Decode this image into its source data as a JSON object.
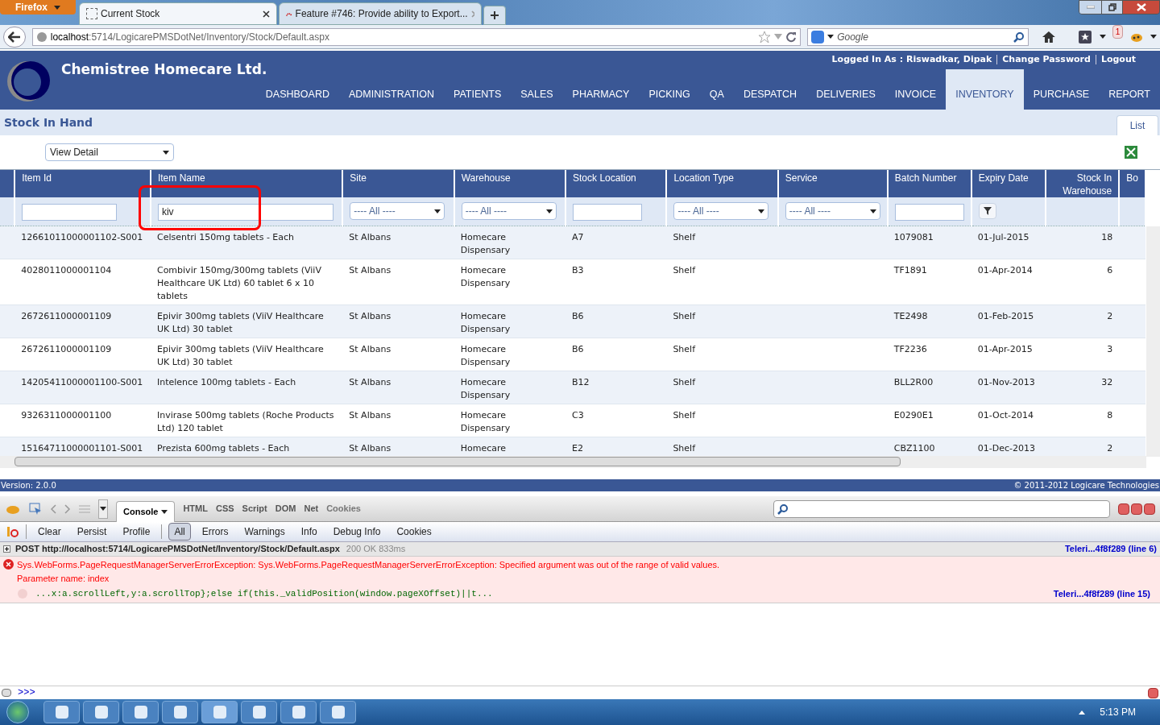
{
  "browser": {
    "menu_button": "Firefox",
    "tabs": [
      {
        "title": "Current Stock",
        "selected": true,
        "kind": "blank"
      },
      {
        "title": "Feature #746: Provide ability to Export...",
        "selected": false,
        "kind": "logo"
      }
    ],
    "url_host": "localhost",
    "url_path": ":5714/LogicarePMSDotNet/Inventory/Stock/Default.aspx",
    "search_placeholder": "Google",
    "badge": "1"
  },
  "site": {
    "company": "Chemistree Homecare Ltd.",
    "user_links": [
      "Logged In As : Riswadkar, Dipak",
      "Change Password",
      "Logout"
    ],
    "nav": [
      {
        "label": "DASHBOARD",
        "selected": false
      },
      {
        "label": "ADMINISTRATION",
        "selected": false
      },
      {
        "label": "PATIENTS",
        "selected": false
      },
      {
        "label": "SALES",
        "selected": false
      },
      {
        "label": "PHARMACY",
        "selected": false
      },
      {
        "label": "PICKING",
        "selected": false
      },
      {
        "label": "QA",
        "selected": false
      },
      {
        "label": "DESPATCH",
        "selected": false
      },
      {
        "label": "DELIVERIES",
        "selected": false
      },
      {
        "label": "INVOICE",
        "selected": false
      },
      {
        "label": "INVENTORY",
        "selected": true
      },
      {
        "label": "PURCHASE",
        "selected": false
      },
      {
        "label": "REPORT",
        "selected": false
      }
    ],
    "page_title": "Stock In Hand",
    "view_tab": "List",
    "view_select": "View Detail"
  },
  "table": {
    "columns": [
      {
        "label": "Item Id",
        "kind": "text"
      },
      {
        "label": "Item Name",
        "kind": "text",
        "value": "kiv"
      },
      {
        "label": "Site",
        "kind": "select",
        "value": "---- All ----"
      },
      {
        "label": "Warehouse",
        "kind": "select",
        "value": "---- All ----"
      },
      {
        "label": "Stock Location",
        "kind": "text"
      },
      {
        "label": "Location Type",
        "kind": "select",
        "value": "---- All ----"
      },
      {
        "label": "Service",
        "kind": "select",
        "value": "---- All ----"
      },
      {
        "label": "Batch Number",
        "kind": "text"
      },
      {
        "label": "Expiry Date",
        "kind": "button"
      },
      {
        "label": "Stock In Warehouse",
        "kind": "none"
      },
      {
        "label": "Bo",
        "kind": "none"
      }
    ],
    "rows": [
      {
        "cells": [
          "12661011000001102-S001",
          "Celsentri 150mg tablets - Each",
          "St Albans",
          "Homecare Dispensary",
          "A7",
          "Shelf",
          "",
          "1079081",
          "01-Jul-2015",
          "18",
          ""
        ]
      },
      {
        "cells": [
          "4028011000001104",
          "Combivir 150mg/300mg tablets (ViiV Healthcare UK Ltd) 60 tablet 6 x 10 tablets",
          "St Albans",
          "Homecare Dispensary",
          "B3",
          "Shelf",
          "",
          "TF1891",
          "01-Apr-2014",
          "6",
          ""
        ]
      },
      {
        "cells": [
          "2672611000001109",
          "Epivir 300mg tablets (ViiV Healthcare UK Ltd) 30 tablet",
          "St Albans",
          "Homecare Dispensary",
          "B6",
          "Shelf",
          "",
          "TE2498",
          "01-Feb-2015",
          "2",
          ""
        ]
      },
      {
        "cells": [
          "2672611000001109",
          "Epivir 300mg tablets (ViiV Healthcare UK Ltd) 30 tablet",
          "St Albans",
          "Homecare Dispensary",
          "B6",
          "Shelf",
          "",
          "TF2236",
          "01-Apr-2015",
          "3",
          ""
        ]
      },
      {
        "cells": [
          "14205411000001100-S001",
          "Intelence 100mg tablets - Each",
          "St Albans",
          "Homecare Dispensary",
          "B12",
          "Shelf",
          "",
          "BLL2R00",
          "01-Nov-2013",
          "32",
          ""
        ]
      },
      {
        "cells": [
          "9326311000001100",
          "Invirase 500mg tablets (Roche Products Ltd) 120 tablet",
          "St Albans",
          "Homecare Dispensary",
          "C3",
          "Shelf",
          "",
          "E0290E1",
          "01-Oct-2014",
          "8",
          ""
        ]
      },
      {
        "cells": [
          "15164711000001101-S001",
          "Prezista 600mg tablets - Each",
          "St Albans",
          "Homecare",
          "E2",
          "Shelf",
          "",
          "CBZ1100",
          "01-Dec-2013",
          "2",
          ""
        ]
      }
    ]
  },
  "footer": {
    "version": "Version: 2.0.0",
    "copyright": "© 2011-2012 Logicare Technologies"
  },
  "firebug": {
    "tabs": [
      {
        "label": "Console",
        "selected": true
      },
      {
        "label": "HTML",
        "selected": false
      },
      {
        "label": "CSS",
        "selected": false
      },
      {
        "label": "Script",
        "selected": false
      },
      {
        "label": "DOM",
        "selected": false
      },
      {
        "label": "Net",
        "selected": false
      },
      {
        "label": "Cookies",
        "selected": false
      }
    ],
    "commands": [
      "Clear",
      "Persist",
      "Profile"
    ],
    "filters": [
      {
        "label": "All",
        "selected": true
      },
      {
        "label": "Errors",
        "selected": false
      },
      {
        "label": "Warnings",
        "selected": false
      },
      {
        "label": "Info",
        "selected": false
      },
      {
        "label": "Debug Info",
        "selected": false
      },
      {
        "label": "Cookies",
        "selected": false
      }
    ],
    "request": {
      "text": "POST http://localhost:5714/LogicarePMSDotNet/Inventory/Stock/Default.aspx",
      "status": "200 OK 833ms",
      "source": "Teleri...4f8f289 (line 6)"
    },
    "error": {
      "message": "Sys.WebForms.PageRequestManagerServerErrorException: Sys.WebForms.PageRequestManagerServerErrorException: Specified argument was out of the range of valid values.",
      "detail": "Parameter name: index",
      "code": "...x:a.scrollLeft,y:a.scrollTop};else if(this._validPosition(window.pageXOffset)||t...",
      "source": "Teleri...4f8f289 (line 15)"
    },
    "prompt": ">>>"
  },
  "taskbar": {
    "time": "5:13 PM"
  }
}
